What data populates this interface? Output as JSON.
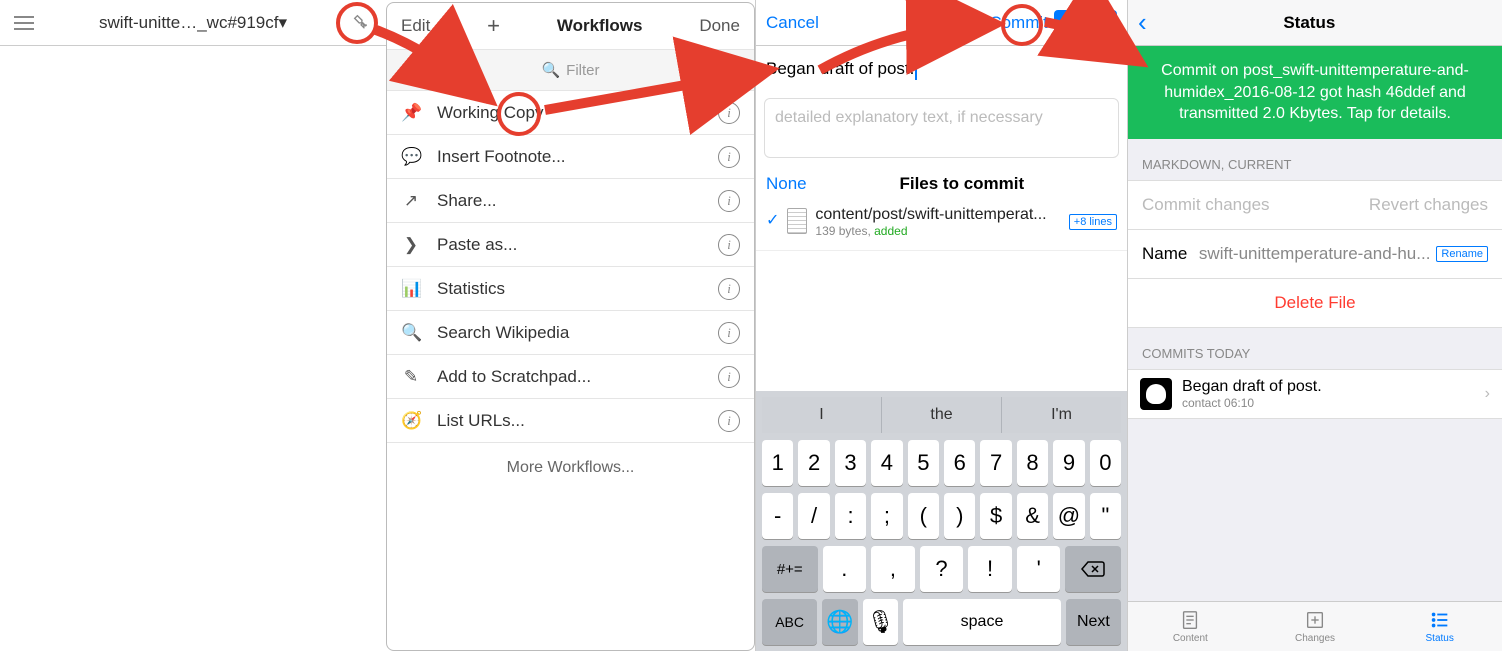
{
  "panel1": {
    "doc_title": "swift-unitte…_wc#919cf▾"
  },
  "workflows": {
    "edit": "Edit",
    "title": "Workflows",
    "done": "Done",
    "filter_placeholder": "Filter",
    "items": [
      {
        "icon": "📌",
        "label": "Working Copy"
      },
      {
        "icon": "💬",
        "label": "Insert Footnote..."
      },
      {
        "icon": "↗",
        "label": "Share..."
      },
      {
        "icon": "❯",
        "label": "Paste as..."
      },
      {
        "icon": "📊",
        "label": "Statistics"
      },
      {
        "icon": "🔍",
        "label": "Search Wikipedia"
      },
      {
        "icon": "✎",
        "label": "Add to Scratchpad..."
      },
      {
        "icon": "🧭",
        "label": "List URLs..."
      }
    ],
    "more": "More Workflows..."
  },
  "commit": {
    "cancel": "Cancel",
    "commit": "Commit",
    "push": "+ Push",
    "message": "Began draft of post.",
    "desc_placeholder": "detailed explanatory text, if necessary",
    "none": "None",
    "files_label": "Files to commit",
    "file": {
      "name": "content/post/swift-unittemperat...",
      "bytes": "139 bytes, ",
      "added": "added",
      "badge": "+8 lines"
    }
  },
  "keyboard": {
    "suggestions": [
      "I",
      "the",
      "I'm"
    ],
    "row1": [
      "1",
      "2",
      "3",
      "4",
      "5",
      "6",
      "7",
      "8",
      "9",
      "0"
    ],
    "row2": [
      "-",
      "/",
      ":",
      ";",
      "(",
      ")",
      "$",
      "&",
      "@",
      "\""
    ],
    "row3": {
      "sym": "#+=",
      "keys": [
        ".",
        ",",
        "?",
        "!",
        "'"
      ],
      "bksp": "⌫"
    },
    "row4": {
      "abc": "ABC",
      "globe": "🌐",
      "mic": "🎤",
      "space": "space",
      "next": "Next"
    }
  },
  "status": {
    "title": "Status",
    "banner": "Commit on post_swift-unittemperature-and-humidex_2016-08-12 got hash 46ddef and transmitted 2.0 Kbytes. Tap for details.",
    "section1": "MARKDOWN, CURRENT",
    "commit_changes": "Commit changes",
    "revert_changes": "Revert changes",
    "name_label": "Name",
    "name_value": "swift-unittemperature-and-hu...",
    "rename": "Rename",
    "delete": "Delete File",
    "section2": "COMMITS TODAY",
    "commit_entry": {
      "title": "Began draft of post.",
      "meta": "contact 06:10"
    },
    "tabs": {
      "content": "Content",
      "changes": "Changes",
      "status": "Status"
    }
  }
}
